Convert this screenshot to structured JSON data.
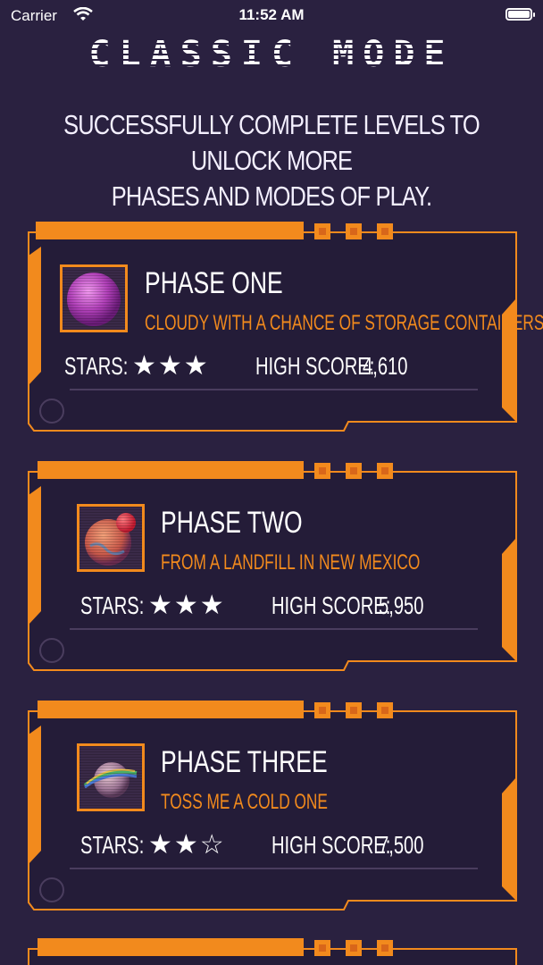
{
  "status_bar": {
    "carrier": "Carrier",
    "time": "11:52 AM"
  },
  "header": {
    "title": "CLASSIC MODE",
    "subtitle_line1": "SUCCESSFULLY COMPLETE LEVELS TO UNLOCK MORE",
    "subtitle_line2": "PHASES AND MODES OF PLAY."
  },
  "labels": {
    "stars": "STARS:",
    "high_score": "HIGH SCORE:"
  },
  "colors": {
    "background": "#2a2140",
    "accent": "#f28a1d",
    "card": "#241c38"
  },
  "phases": [
    {
      "name": "PHASE ONE",
      "tagline": "CLOUDY WITH A CHANCE OF STORAGE CONTAINERS",
      "stars_display": "★★★",
      "stars": 3,
      "high_score": "4,610",
      "icon": "purple-planet-icon"
    },
    {
      "name": "PHASE TWO",
      "tagline": "FROM A LANDFILL IN NEW MEXICO",
      "stars_display": "★★★",
      "stars": 3,
      "high_score": "5,950",
      "icon": "earth-planet-icon"
    },
    {
      "name": "PHASE THREE",
      "tagline": "TOSS ME A COLD ONE",
      "stars_display": "★★☆",
      "stars": 2,
      "high_score": "7,500",
      "icon": "ringed-planet-icon"
    }
  ]
}
